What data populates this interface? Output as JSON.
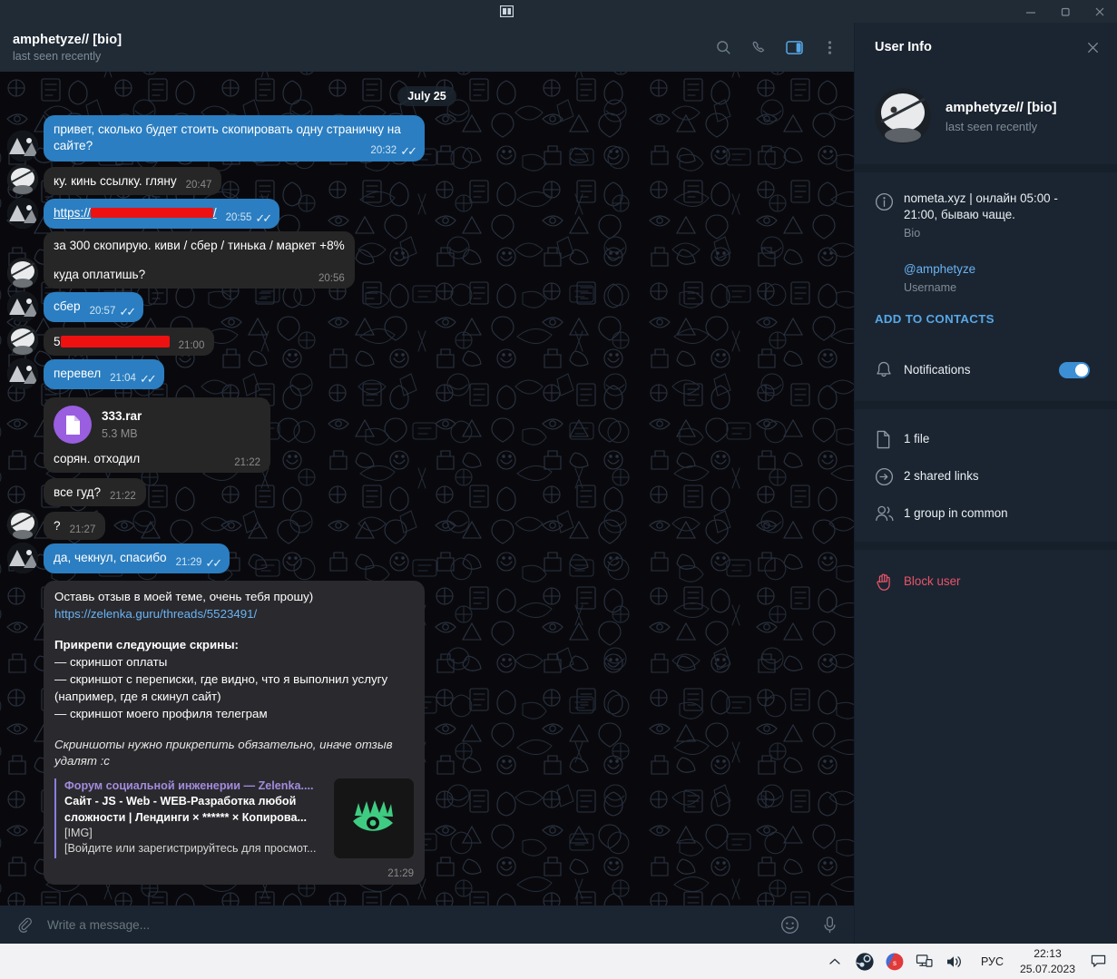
{
  "window": {
    "minimize_label": "—",
    "maximize_label": "❐",
    "close_label": "✕",
    "tray_icon": "window-preview-icon"
  },
  "chat_header": {
    "title": "amphetyze// [bio]",
    "subtitle": "last seen recently",
    "icons": [
      {
        "name": "search-icon",
        "label": "Search"
      },
      {
        "name": "phone-icon",
        "label": "Call"
      },
      {
        "name": "info-panel-icon",
        "label": "Info"
      },
      {
        "name": "more-vertical-icon",
        "label": "More"
      }
    ]
  },
  "chat": {
    "date_separator": "July 25",
    "messages": [
      {
        "id": "m1",
        "side": "out",
        "type": "text",
        "text": "привет, сколько будет стоить скопировать одну страничку на сайте?",
        "time": "20:32",
        "ticks": "✓✓",
        "avatar": "out"
      },
      {
        "id": "m2",
        "side": "in",
        "type": "text",
        "text": "ку. кинь ссылку. гляну",
        "time": "20:47",
        "ticks": "",
        "avatar": "in"
      },
      {
        "id": "m3",
        "side": "out",
        "type": "link-redacted",
        "text": "https://",
        "redacted_label": "redacted-url",
        "suffix": "/",
        "time": "20:55",
        "ticks": "✓✓",
        "avatar": "out"
      },
      {
        "id": "m4",
        "side": "in",
        "type": "multiline",
        "line1": "за 300 скопирую. киви / сбер / тинька / маркет +8%",
        "line2": "куда оплатишь?",
        "time": "20:56",
        "ticks": "",
        "avatar": "in"
      },
      {
        "id": "m5",
        "side": "out",
        "type": "text",
        "text": "сбер",
        "time": "20:57",
        "ticks": "✓✓",
        "avatar": "out"
      },
      {
        "id": "m6",
        "side": "in",
        "type": "redacted-text",
        "prefix": "5",
        "redacted_label": "redacted-card-number",
        "time": "21:00",
        "ticks": "",
        "avatar": "in"
      },
      {
        "id": "m7",
        "side": "out",
        "type": "text",
        "text": "перевел",
        "time": "21:04",
        "ticks": "✓✓",
        "avatar": "out"
      },
      {
        "id": "m8",
        "side": "in",
        "type": "file",
        "file_name": "333.rar",
        "file_size": "5.3 MB",
        "caption": "сорян. отходил",
        "time": "21:22",
        "ticks": "",
        "avatar": "none"
      },
      {
        "id": "m9",
        "side": "in",
        "type": "text",
        "text": "все гуд?",
        "time": "21:22",
        "ticks": "",
        "avatar": "none"
      },
      {
        "id": "m10",
        "side": "in",
        "type": "text",
        "text": "?",
        "time": "21:27",
        "ticks": "",
        "avatar": "in"
      },
      {
        "id": "m11",
        "side": "out",
        "type": "text",
        "text": "да, чекнул, спасибо",
        "time": "21:29",
        "ticks": "✓✓",
        "avatar": "out"
      }
    ],
    "long_message": {
      "line_request": "Оставь отзыв в моей теме, очень тебя прошу)",
      "link": "https://zelenka.guru/threads/5523491/",
      "heading": "Прикрепи следующие скрины:",
      "bullets": [
        "— скриншот оплаты",
        "— скриншот с переписки, где видно, что я выполнил услугу (например, где я скинул сайт)",
        "— скриншот моего профиля телеграм"
      ],
      "italic_note": "Скриншоты нужно прикрепить обязательно, иначе отзыв удалят :с",
      "preview": {
        "site": "Форум социальной инженерии —  Zelenka....",
        "title_line1": "Сайт - JS - Web - WEB-Разработка любой",
        "title_line2": "сложности | Лендинги × ****** × Копирова...",
        "desc_line1": "[IMG]",
        "desc_line2": "[Войдите или зарегистрируйтесь для просмот...",
        "thumb_icon": "green-eye-logo"
      },
      "time": "21:29"
    }
  },
  "composer": {
    "attach_icon": "paperclip-icon",
    "placeholder": "Write a message...",
    "value": "",
    "emoji_icon": "smiley-icon",
    "mic_icon": "microphone-icon"
  },
  "user_info": {
    "panel_title": "User Info",
    "close_label": "✕",
    "name": "amphetyze// [bio]",
    "status": "last seen recently",
    "bio_value": "nometa.xyz | онлайн 05:00 - 21:00, бываю чаще.",
    "bio_label": "Bio",
    "username_value": "@amphetyze",
    "username_label": "Username",
    "add_to_contacts": "ADD TO CONTACTS",
    "notifications_label": "Notifications",
    "notifications_on": true,
    "rows": [
      {
        "icon": "file-icon",
        "label": "1 file"
      },
      {
        "icon": "link-icon",
        "label": "2 shared links"
      },
      {
        "icon": "group-icon",
        "label": "1 group in common"
      }
    ],
    "block_user": "Block user"
  },
  "taskbar": {
    "chevron_icon": "chevron-up-icon",
    "tray_icons": [
      "steam-icon",
      "app-red-icon",
      "network-icon",
      "volume-icon"
    ],
    "language": "РУС",
    "time": "22:13",
    "date": "25.07.2023",
    "notification_icon": "notification-icon"
  },
  "colors": {
    "accent": "#57a7e7",
    "out_bubble": "#2b7ec1",
    "in_bubble": "#262626",
    "panel_bg": "#1b2531",
    "header_bg": "#202b36",
    "danger": "#e8546a",
    "file_icon": "#9a5ee0",
    "preview_bar": "#8a7de0",
    "eye_green": "#3fcc82",
    "redaction": "#ee1111"
  }
}
